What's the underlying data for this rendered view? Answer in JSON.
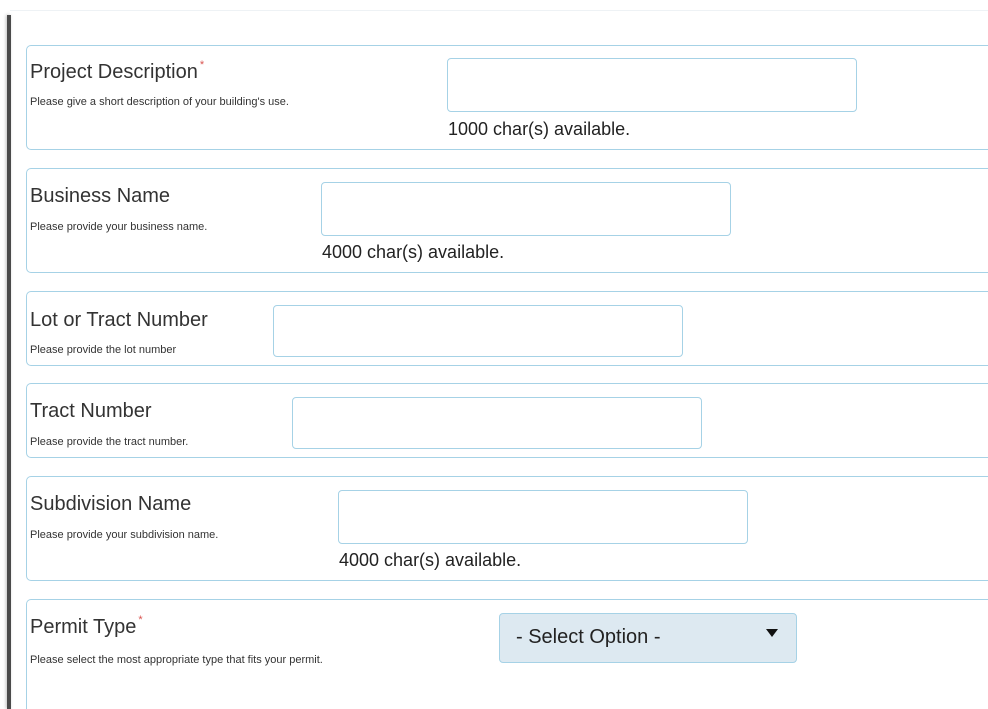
{
  "form": {
    "project_description": {
      "label": "Project Description",
      "required_mark": "*",
      "help": "Please give a short description of your building's use.",
      "value": "",
      "counter": "1000 char(s) available."
    },
    "business_name": {
      "label": "Business Name",
      "help": "Please provide your business name.",
      "value": "",
      "counter": "4000 char(s) available."
    },
    "lot_or_tract_number": {
      "label": "Lot or Tract Number",
      "help": "Please provide the lot number",
      "value": ""
    },
    "tract_number": {
      "label": "Tract Number",
      "help": "Please provide the tract number.",
      "value": ""
    },
    "subdivision_name": {
      "label": "Subdivision Name",
      "help": "Please provide your subdivision name.",
      "value": "",
      "counter": "4000 char(s) available."
    },
    "permit_type": {
      "label": "Permit Type",
      "required_mark": "*",
      "help": "Please select the most appropriate type that fits your permit.",
      "selected": "- Select Option -"
    }
  },
  "colors": {
    "border": "#a6d2e6",
    "required": "#d9534f",
    "select_bg": "#dde9f1"
  }
}
